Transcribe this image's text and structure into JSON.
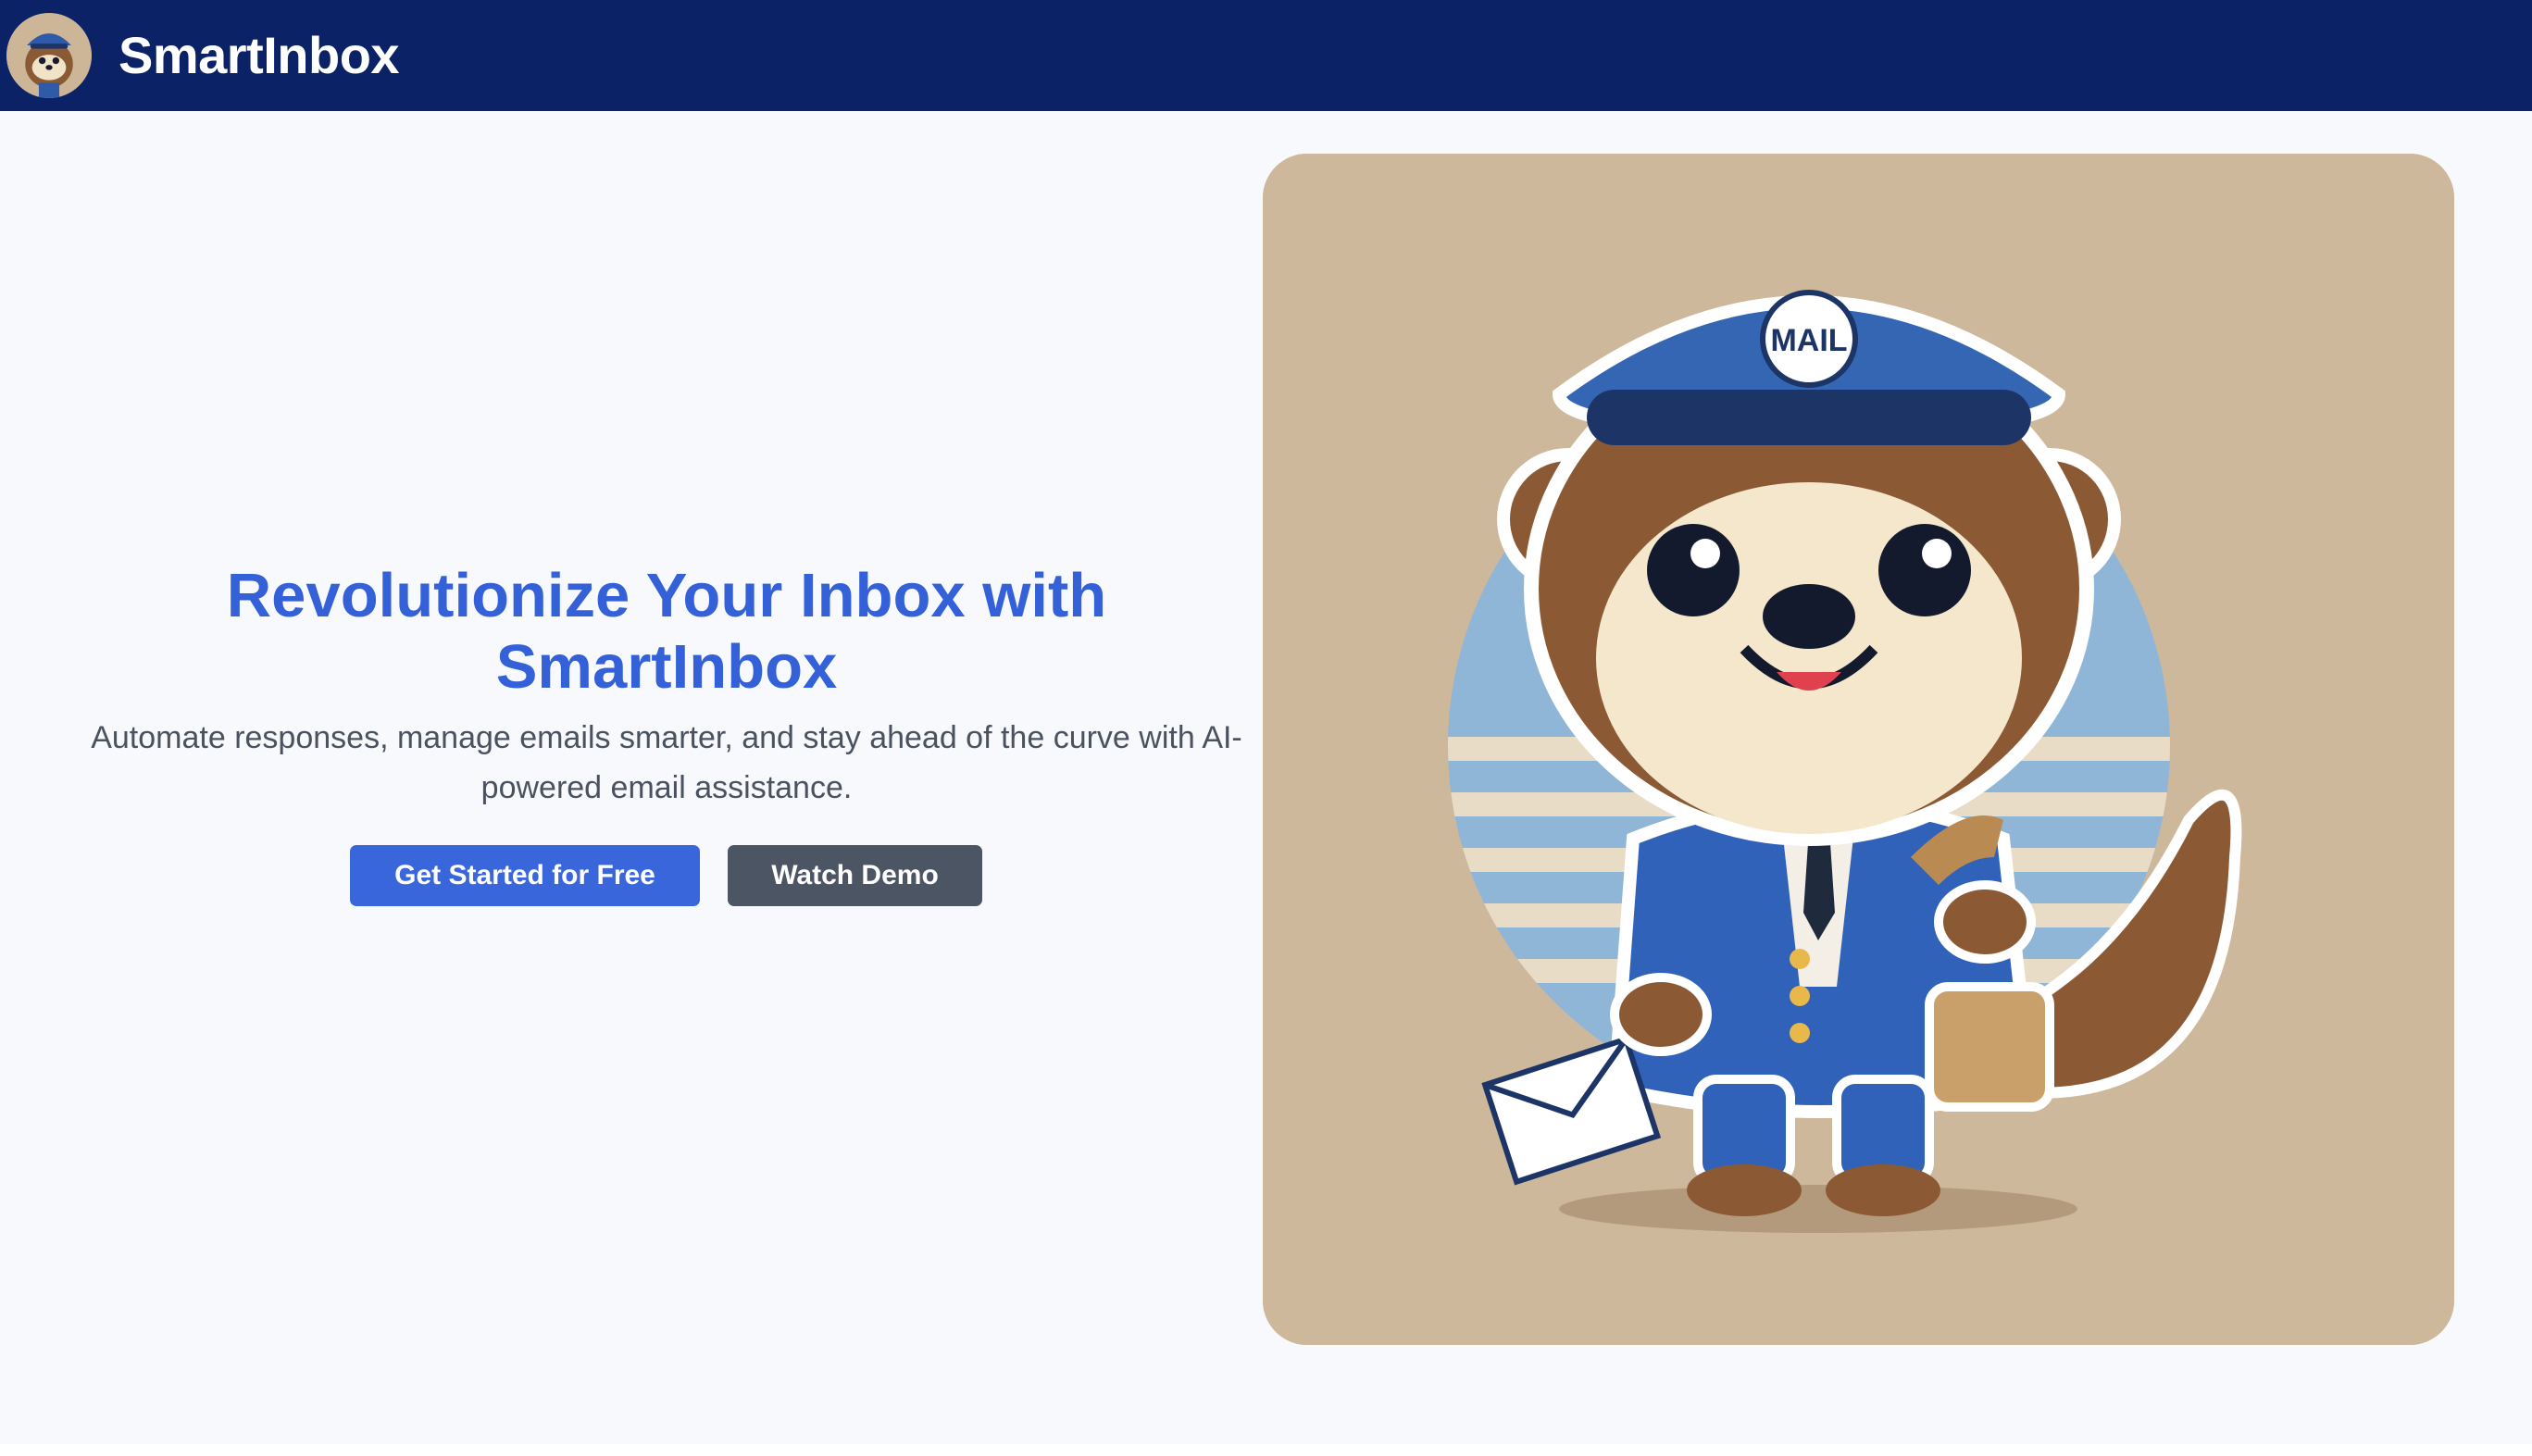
{
  "header": {
    "brand": "SmartInbox",
    "logo_icon": "otter-mail-carrier-avatar",
    "background_color": "#0b2266"
  },
  "hero": {
    "title": "Revolutionize Your Inbox with SmartInbox",
    "subtitle": "Automate responses, manage emails smarter, and stay ahead of the curve with AI-powered email assistance.",
    "primary_button": "Get Started for Free",
    "secondary_button": "Watch Demo",
    "illustration": {
      "icon": "otter-mail-carrier-illustration",
      "hat_text": "MAIL"
    },
    "accent_color": "#3461d8"
  }
}
